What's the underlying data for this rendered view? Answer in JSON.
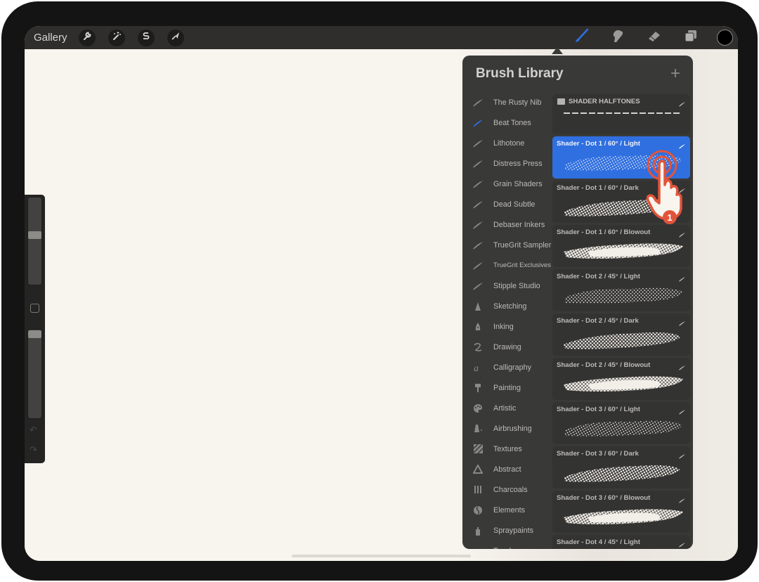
{
  "topbar": {
    "gallery_label": "Gallery",
    "left_tools": [
      {
        "name": "actions",
        "icon": "wrench-icon"
      },
      {
        "name": "adjustments",
        "icon": "magic-wand-icon"
      },
      {
        "name": "selection",
        "icon": "selection-s-icon"
      },
      {
        "name": "transform",
        "icon": "arrow-cursor-icon"
      }
    ],
    "right_tools": [
      {
        "name": "brush",
        "icon": "brush-icon",
        "active": true
      },
      {
        "name": "smudge",
        "icon": "smudge-finger-icon",
        "active": false
      },
      {
        "name": "eraser",
        "icon": "eraser-icon",
        "active": false
      },
      {
        "name": "layers",
        "icon": "layers-icon",
        "active": false
      }
    ],
    "current_color": "#000000",
    "accent_color": "#2f6fe0"
  },
  "sidebar": {
    "brush_size_fraction": 0.4,
    "opacity_fraction": 1.0,
    "undo_icon": "undo-icon",
    "redo_icon": "redo-icon"
  },
  "brush_library": {
    "title": "Brush Library",
    "add_label": "+",
    "sets": [
      {
        "label": "The Rusty Nib",
        "icon": "brush-stroke-icon"
      },
      {
        "label": "Beat Tones",
        "icon": "brush-stroke-icon",
        "selected": true
      },
      {
        "label": "Lithotone",
        "icon": "brush-stroke-icon"
      },
      {
        "label": "Distress Press",
        "icon": "brush-stroke-icon"
      },
      {
        "label": "Grain Shaders",
        "icon": "brush-stroke-icon"
      },
      {
        "label": "Dead Subtle",
        "icon": "brush-stroke-icon"
      },
      {
        "label": "Debaser Inkers",
        "icon": "brush-stroke-icon"
      },
      {
        "label": "TrueGrit Sampler",
        "icon": "brush-stroke-icon"
      },
      {
        "label": "TrueGrit Exclusives",
        "icon": "brush-stroke-icon"
      },
      {
        "label": "Stipple Studio",
        "icon": "brush-stroke-icon"
      },
      {
        "label": "Sketching",
        "icon": "pencil-tip-icon"
      },
      {
        "label": "Inking",
        "icon": "pen-nib-icon"
      },
      {
        "label": "Drawing",
        "icon": "squiggle-icon"
      },
      {
        "label": "Calligraphy",
        "icon": "calligraphy-a-icon"
      },
      {
        "label": "Painting",
        "icon": "paintbrush-icon"
      },
      {
        "label": "Artistic",
        "icon": "palette-icon"
      },
      {
        "label": "Airbrushing",
        "icon": "airbrush-icon"
      },
      {
        "label": "Textures",
        "icon": "texture-icon"
      },
      {
        "label": "Abstract",
        "icon": "triangle-icon"
      },
      {
        "label": "Charcoals",
        "icon": "charcoal-icon"
      },
      {
        "label": "Elements",
        "icon": "yin-yang-icon"
      },
      {
        "label": "Spraypaints",
        "icon": "spray-can-icon"
      },
      {
        "label": "Touchups",
        "icon": "touchup-icon"
      }
    ],
    "folder": {
      "label": "SHADER HALFTONES"
    },
    "brushes": [
      {
        "label": "Shader - Dot  1 / 60° / Light",
        "selected": true
      },
      {
        "label": "Shader - Dot  1 / 60° / Dark"
      },
      {
        "label": "Shader - Dot  1 / 60° / Blowout"
      },
      {
        "label": "Shader - Dot  2 / 45° / Light"
      },
      {
        "label": "Shader - Dot  2 / 45° / Dark"
      },
      {
        "label": "Shader - Dot  2 / 45° / Blowout"
      },
      {
        "label": "Shader - Dot  3 / 60° / Light"
      },
      {
        "label": "Shader - Dot  3 / 60° / Dark"
      },
      {
        "label": "Shader - Dot  3 / 60° / Blowout"
      },
      {
        "label": "Shader - Dot  4 / 45° / Light"
      }
    ]
  },
  "annotation": {
    "step_number": "1",
    "color": "#e2543a"
  }
}
